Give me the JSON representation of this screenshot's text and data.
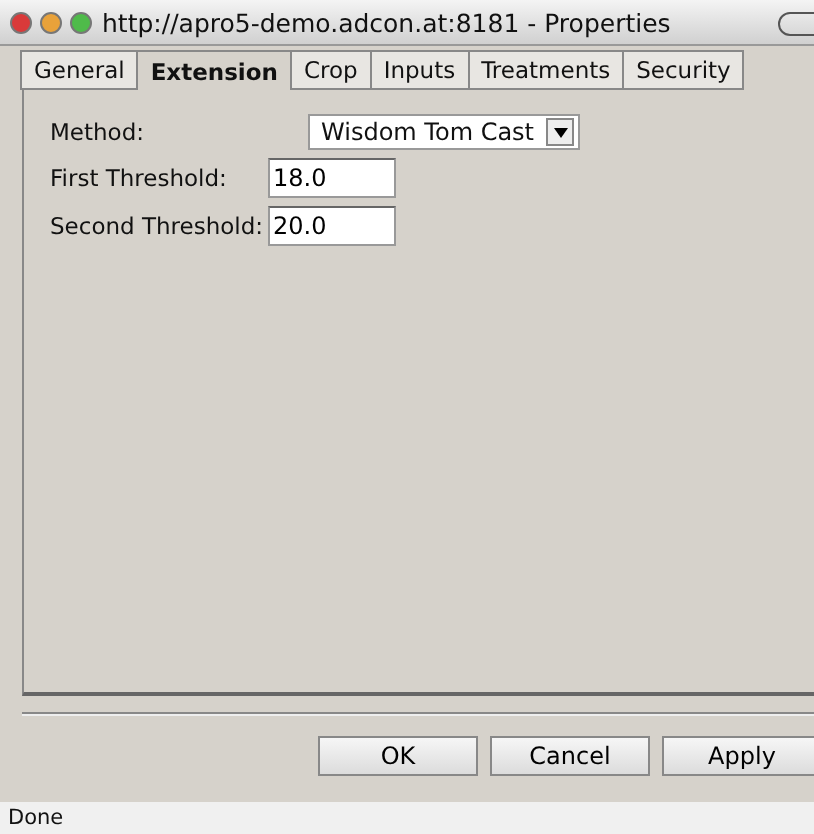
{
  "window": {
    "title": "http://apro5-demo.adcon.at:8181 - Properties"
  },
  "tabs": [
    {
      "label": "General",
      "selected": false
    },
    {
      "label": "Extension",
      "selected": true
    },
    {
      "label": "Crop",
      "selected": false
    },
    {
      "label": "Inputs",
      "selected": false
    },
    {
      "label": "Treatments",
      "selected": false
    },
    {
      "label": "Security",
      "selected": false
    }
  ],
  "form": [
    {
      "kind": "select",
      "label": "Method:",
      "value": "Wisdom Tom Cast"
    },
    {
      "kind": "input",
      "label": "First Threshold:",
      "value": "18.0"
    },
    {
      "kind": "input",
      "label": "Second Threshold:",
      "value": "20.0"
    }
  ],
  "buttons": [
    "OK",
    "Cancel",
    "Apply"
  ],
  "status_bar": "Done"
}
